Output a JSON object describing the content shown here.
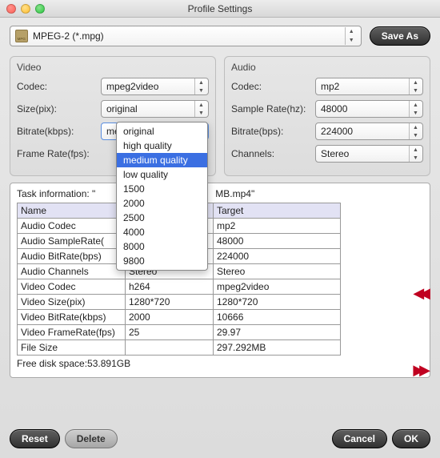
{
  "window": {
    "title": "Profile Settings"
  },
  "top": {
    "profile": "MPEG-2 (*.mpg)",
    "saveas": "Save As"
  },
  "video": {
    "title": "Video",
    "codec_label": "Codec:",
    "codec": "mpeg2video",
    "size_label": "Size(pix):",
    "size": "original",
    "bitrate_label": "Bitrate(kbps):",
    "bitrate": "medium quality",
    "fps_label": "Frame Rate(fps):",
    "fps": "",
    "bitrate_options": [
      "original",
      "high quality",
      "medium quality",
      "low quality",
      "1500",
      "2000",
      "2500",
      "4000",
      "8000",
      "9800"
    ]
  },
  "audio": {
    "title": "Audio",
    "codec_label": "Codec:",
    "codec": "mp2",
    "samplerate_label": "Sample Rate(hz):",
    "samplerate": "48000",
    "bitrate_label": "Bitrate(bps):",
    "bitrate": "224000",
    "channels_label": "Channels:",
    "channels": "Stereo"
  },
  "task": {
    "title_prefix": "Task information: \"",
    "title_suffix": "MB.mp4\"",
    "header_name": "Name",
    "header_target": "Target",
    "rows": [
      {
        "name": "Audio Codec",
        "src": "",
        "tgt": "mp2"
      },
      {
        "name": "Audio SampleRate(",
        "src": "",
        "tgt": "48000"
      },
      {
        "name": "Audio BitRate(bps)",
        "src": "",
        "tgt": "224000"
      },
      {
        "name": "Audio Channels",
        "src": "Stereo",
        "tgt": "Stereo"
      },
      {
        "name": "Video Codec",
        "src": "h264",
        "tgt": "mpeg2video"
      },
      {
        "name": "Video Size(pix)",
        "src": "1280*720",
        "tgt": "1280*720"
      },
      {
        "name": "Video BitRate(kbps)",
        "src": "2000",
        "tgt": "10666"
      },
      {
        "name": "Video FrameRate(fps)",
        "src": "25",
        "tgt": "29.97"
      },
      {
        "name": "File Size",
        "src": "",
        "tgt": "297.292MB"
      }
    ],
    "free_space": "Free disk space:53.891GB"
  },
  "buttons": {
    "reset": "Reset",
    "delete": "Delete",
    "cancel": "Cancel",
    "ok": "OK"
  }
}
